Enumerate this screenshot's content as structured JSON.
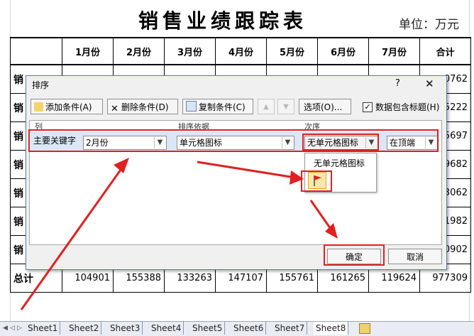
{
  "sheet": {
    "title": "销售业绩跟踪表",
    "unit": "单位：万元",
    "headers": [
      "",
      "1月份",
      "2月份",
      "3月份",
      "4月份",
      "5月份",
      "6月份",
      "7月份",
      "合计"
    ],
    "rows": [
      {
        "label": "销",
        "total": "0762"
      },
      {
        "label": "销",
        "total": "5222"
      },
      {
        "label": "销",
        "total": "5697"
      },
      {
        "label": "销",
        "total": "9682"
      },
      {
        "label": "销",
        "total": "3062"
      },
      {
        "label": "销",
        "total": "1982"
      },
      {
        "label": "销",
        "total": "0902"
      }
    ],
    "total_row": {
      "label": "总计",
      "values": [
        "104901",
        "155388",
        "133263",
        "147107",
        "155761",
        "161265",
        "119624",
        "977309"
      ]
    }
  },
  "tabs": [
    "Sheet1",
    "Sheet2",
    "Sheet3",
    "Sheet4",
    "Sheet5",
    "Sheet6",
    "Sheet7",
    "Sheet8"
  ],
  "active_tab": "Sheet8",
  "dialog": {
    "title": "排序",
    "help": "?",
    "close": "✕",
    "add_condition": "添加条件(A)",
    "delete_condition": "删除条件(D)",
    "copy_condition": "复制条件(C)",
    "options": "选项(O)...",
    "header_checkbox": "数据包含标题(H)",
    "header_checked": "✓",
    "col_header_column": "列",
    "col_header_sort_on": "排序依据",
    "col_header_order": "次序",
    "row_label": "主要关键字",
    "column_value": "2月份",
    "sort_on_value": "单元格图标",
    "order_value": "无单元格图标",
    "position_value": "在顶端",
    "popup_item": "无单元格图标",
    "ok": "确定",
    "cancel": "取消"
  },
  "colors": {
    "annotation": "#e02020",
    "dialog_border": "#5f7ea6",
    "row_highlight": "#dbe7f6"
  }
}
